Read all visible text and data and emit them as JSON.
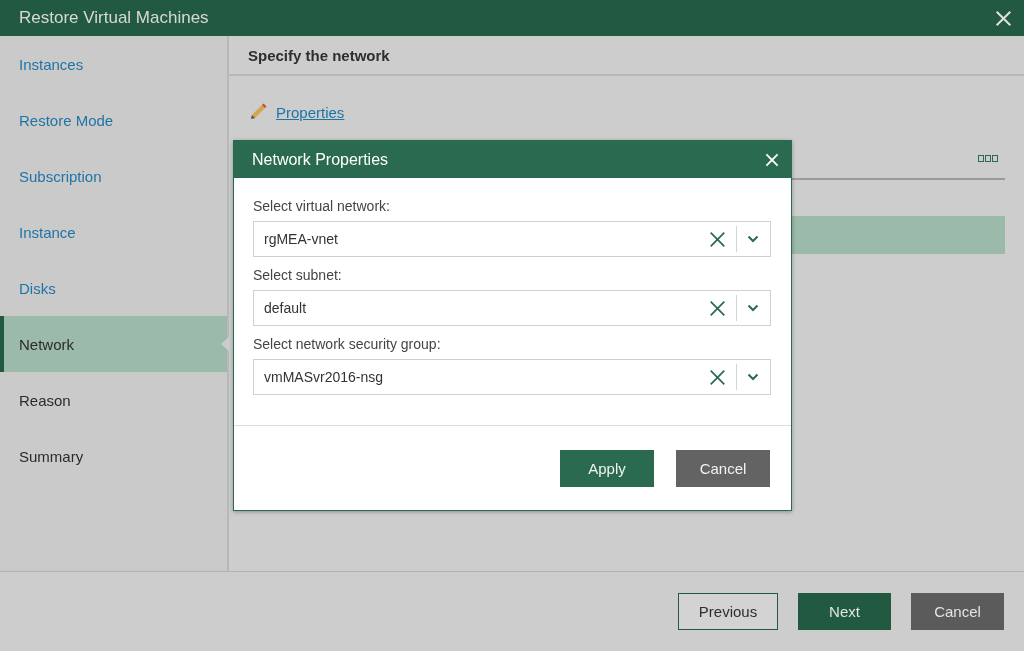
{
  "window": {
    "title": "Restore Virtual Machines"
  },
  "sidebar": {
    "items": [
      {
        "label": "Instances",
        "selected": false,
        "done": true
      },
      {
        "label": "Restore Mode",
        "selected": false,
        "done": true
      },
      {
        "label": "Subscription",
        "selected": false,
        "done": true
      },
      {
        "label": "Instance",
        "selected": false,
        "done": true
      },
      {
        "label": "Disks",
        "selected": false,
        "done": true
      },
      {
        "label": "Network",
        "selected": true,
        "done": false
      },
      {
        "label": "Reason",
        "selected": false,
        "done": false
      },
      {
        "label": "Summary",
        "selected": false,
        "done": false
      }
    ]
  },
  "content": {
    "title": "Specify the network",
    "properties_link": "Properties"
  },
  "dialog": {
    "title": "Network Properties",
    "fields": [
      {
        "label": "Select virtual network:",
        "value": "rgMEA-vnet"
      },
      {
        "label": "Select subnet:",
        "value": "default"
      },
      {
        "label": "Select network security group:",
        "value": "vmMASvr2016-nsg"
      }
    ],
    "buttons": [
      {
        "label": "Apply",
        "kind": "primary"
      },
      {
        "label": "Cancel",
        "kind": "neutral"
      }
    ]
  },
  "footer": {
    "buttons": [
      {
        "label": "Previous",
        "kind": "secondary"
      },
      {
        "label": "Next",
        "kind": "primary"
      },
      {
        "label": "Cancel",
        "kind": "neutral"
      }
    ]
  }
}
